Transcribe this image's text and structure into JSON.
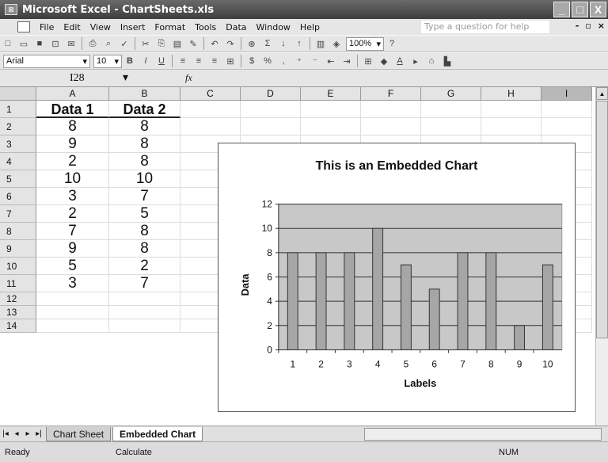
{
  "window": {
    "title": "Microsoft Excel - ChartSheets.xls",
    "controls": [
      "_",
      "□",
      "X"
    ]
  },
  "menubar": {
    "items": [
      "File",
      "Edit",
      "View",
      "Insert",
      "Format",
      "Tools",
      "Data",
      "Window",
      "Help"
    ],
    "help_placeholder": "Type a question for help"
  },
  "toolbar": {
    "zoom": "100%",
    "font_name": "Arial",
    "font_size": "10"
  },
  "formula_bar": {
    "name_box": "I28",
    "fx_label": "fx"
  },
  "columns": [
    "A",
    "B",
    "C",
    "D",
    "E",
    "F",
    "G",
    "H",
    "I"
  ],
  "selected_column": "I",
  "rows": [
    "1",
    "2",
    "3",
    "4",
    "5",
    "6",
    "7",
    "8",
    "9",
    "10",
    "11",
    "12",
    "13",
    "14"
  ],
  "sheet": {
    "headers": [
      "Data 1",
      "Data 2"
    ],
    "values": [
      [
        "8",
        "8"
      ],
      [
        "9",
        "8"
      ],
      [
        "2",
        "8"
      ],
      [
        "10",
        "10"
      ],
      [
        "3",
        "7"
      ],
      [
        "2",
        "5"
      ],
      [
        "7",
        "8"
      ],
      [
        "9",
        "8"
      ],
      [
        "5",
        "2"
      ],
      [
        "3",
        "7"
      ]
    ]
  },
  "chart_data": {
    "type": "bar",
    "title": "This is an Embedded Chart",
    "xlabel": "Labels",
    "ylabel": "Data",
    "categories": [
      "1",
      "2",
      "3",
      "4",
      "5",
      "6",
      "7",
      "8",
      "9",
      "10"
    ],
    "values": [
      8,
      8,
      8,
      10,
      7,
      5,
      8,
      8,
      2,
      7
    ],
    "ylim": [
      0,
      12
    ],
    "yticks": [
      0,
      2,
      4,
      6,
      8,
      10,
      12
    ],
    "grid": true,
    "legend": "none",
    "plot_color": "#c8c8c8",
    "bar_color": "#a6a6a6"
  },
  "sheet_tabs": {
    "tabs": [
      "Chart Sheet",
      "Embedded Chart"
    ],
    "active": "Embedded Chart"
  },
  "statusbar": {
    "ready": "Ready",
    "calculate": "Calculate",
    "num": "NUM"
  }
}
